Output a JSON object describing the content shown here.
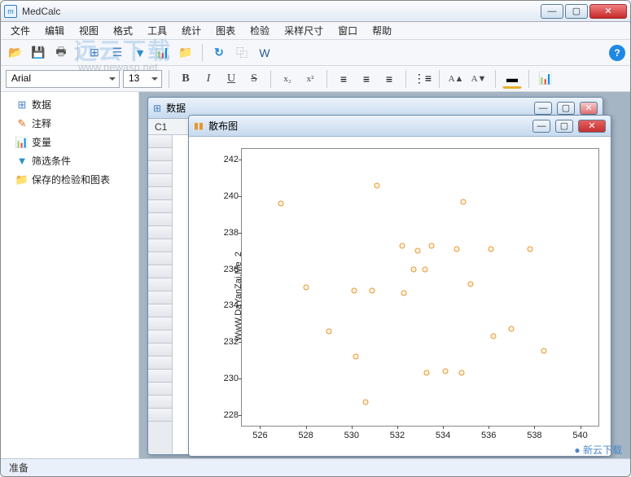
{
  "app": {
    "title": "MedCalc"
  },
  "menus": [
    "文件",
    "编辑",
    "视图",
    "格式",
    "工具",
    "统计",
    "图表",
    "检验",
    "采样尺寸",
    "窗口",
    "帮助"
  ],
  "font": {
    "name": "Arial",
    "size": "13"
  },
  "fmt": {
    "bold": "B",
    "italic": "I",
    "underline": "U",
    "strike": "S",
    "sub": "x₂",
    "sup": "x²",
    "fontplus": "A▲",
    "fontminus": "A▼"
  },
  "sidebar": {
    "items": [
      {
        "icon": "⊞",
        "label": "数据",
        "color": "#4a80c0"
      },
      {
        "icon": "✎",
        "label": "注释",
        "color": "#e06a1a"
      },
      {
        "icon": "📊",
        "label": "变量",
        "color": "#3a8ec8"
      },
      {
        "icon": "▼",
        "label": "筛选条件",
        "color": "#2d8fc6"
      },
      {
        "icon": "📁",
        "label": "保存的检验和图表",
        "color": "#d4a028"
      }
    ]
  },
  "data_window": {
    "title": "数据",
    "cell": "C1"
  },
  "chart_window": {
    "title": "散布图"
  },
  "chart_data": {
    "type": "scatter",
    "title": "",
    "xlabel": "",
    "ylabel": "WwW.DaYanZai.Me_2",
    "xticks": [
      526,
      528,
      530,
      532,
      534,
      536,
      538,
      540
    ],
    "yticks": [
      228,
      230,
      232,
      234,
      236,
      238,
      240,
      242
    ],
    "xlim": [
      525.2,
      540.8
    ],
    "ylim": [
      227.4,
      242.6
    ],
    "points": [
      {
        "x": 526.9,
        "y": 239.6
      },
      {
        "x": 528.0,
        "y": 235.0
      },
      {
        "x": 529.0,
        "y": 232.6
      },
      {
        "x": 530.1,
        "y": 234.8
      },
      {
        "x": 530.2,
        "y": 231.2
      },
      {
        "x": 530.6,
        "y": 228.7
      },
      {
        "x": 530.9,
        "y": 234.8
      },
      {
        "x": 531.1,
        "y": 240.6
      },
      {
        "x": 532.2,
        "y": 237.3
      },
      {
        "x": 532.3,
        "y": 234.7
      },
      {
        "x": 532.9,
        "y": 237.0
      },
      {
        "x": 532.7,
        "y": 236.0
      },
      {
        "x": 533.2,
        "y": 236.0
      },
      {
        "x": 533.5,
        "y": 237.3
      },
      {
        "x": 533.3,
        "y": 230.3
      },
      {
        "x": 534.1,
        "y": 230.4
      },
      {
        "x": 534.6,
        "y": 237.1
      },
      {
        "x": 534.8,
        "y": 230.3
      },
      {
        "x": 534.9,
        "y": 239.7
      },
      {
        "x": 535.2,
        "y": 235.2
      },
      {
        "x": 536.1,
        "y": 237.1
      },
      {
        "x": 536.2,
        "y": 232.3
      },
      {
        "x": 537.0,
        "y": 232.7
      },
      {
        "x": 537.8,
        "y": 237.1
      },
      {
        "x": 538.4,
        "y": 231.5
      }
    ]
  },
  "status": {
    "text": "准备"
  },
  "watermark": {
    "main": "远云下载",
    "sub": "www.newasp.net",
    "corner": "● 新云下载"
  }
}
